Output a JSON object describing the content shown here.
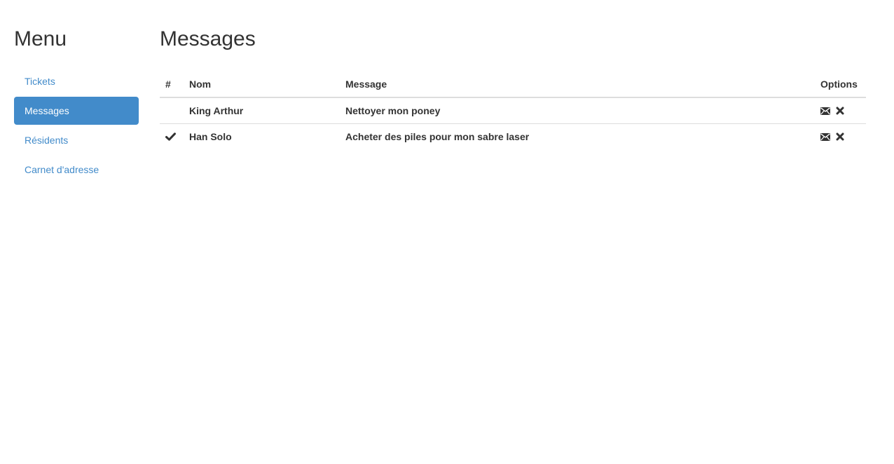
{
  "sidebar": {
    "title": "Menu",
    "items": [
      {
        "label": "Tickets",
        "active": false
      },
      {
        "label": "Messages",
        "active": true
      },
      {
        "label": "Résidents",
        "active": false
      },
      {
        "label": "Carnet d'adresse",
        "active": false
      }
    ]
  },
  "main": {
    "title": "Messages",
    "table": {
      "headers": {
        "hash": "#",
        "nom": "Nom",
        "message": "Message",
        "options": "Options"
      },
      "rows": [
        {
          "status_icon": "",
          "nom": "King Arthur",
          "message": "Nettoyer mon poney",
          "options": [
            "envelope-icon",
            "remove-icon"
          ]
        },
        {
          "status_icon": "checkmark-icon",
          "nom": "Han Solo",
          "message": "Acheter des piles pour mon sabre laser",
          "options": [
            "envelope-icon",
            "remove-icon"
          ]
        }
      ]
    }
  },
  "colors": {
    "accent": "#428bca",
    "text": "#333333",
    "border": "#dddddd"
  }
}
